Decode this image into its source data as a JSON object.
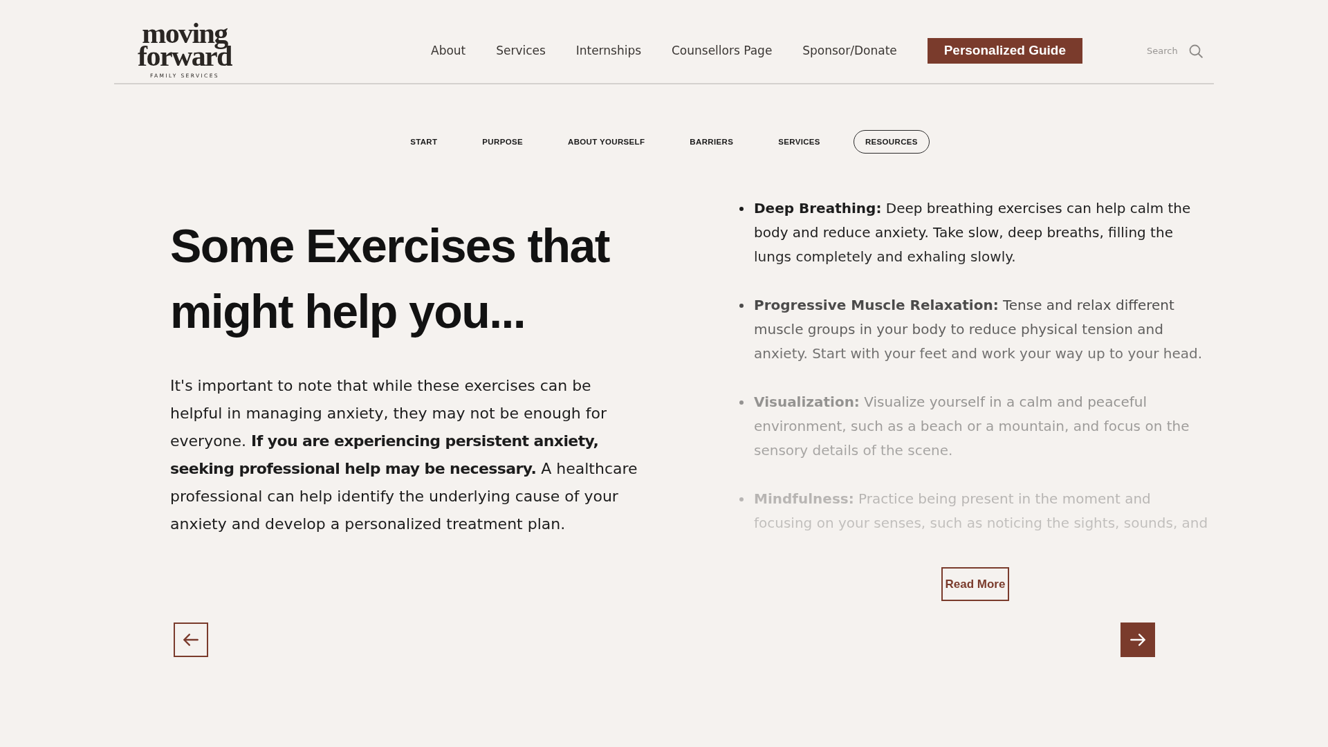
{
  "logo": {
    "wordmark": [
      "moving",
      "forward"
    ],
    "tagline": "FAMILY SERVICES"
  },
  "nav": {
    "items": [
      {
        "label": "About",
        "kind": "link"
      },
      {
        "label": "Services",
        "kind": "link"
      },
      {
        "label": "Internships",
        "kind": "link"
      },
      {
        "label": "Counsellors Page",
        "kind": "link"
      },
      {
        "label": "Sponsor/Donate",
        "kind": "link"
      },
      {
        "label": "Personalized Guide",
        "kind": "button"
      }
    ]
  },
  "search": {
    "placeholder": "Search"
  },
  "steps": [
    {
      "label": "START",
      "selected": false
    },
    {
      "label": "PURPOSE",
      "selected": false
    },
    {
      "label": "ABOUT YOURSELF",
      "selected": false
    },
    {
      "label": "BARRIERS",
      "selected": false
    },
    {
      "label": "SERVICES",
      "selected": false
    },
    {
      "label": "RESOURCES",
      "selected": true
    }
  ],
  "heading": "Some Exercises that might help you...",
  "intro": "It's important to note that while these exercises can be helpful in managing anxiety, they may not be enough for everyone. **If you are experiencing persistent anxiety, seeking professional help may be necessary.** A healthcare professional can help identify the underlying cause of your anxiety and develop a personalized treatment plan.",
  "exercises": {
    "expanded": false,
    "items": [
      "**Deep Breathing:** Deep breathing exercises can help calm the body and reduce anxiety. Take slow, deep breaths, filling the lungs completely and exhaling slowly.",
      "**Progressive Muscle Relaxation:** Tense and relax different muscle groups in your body to reduce physical tension and anxiety. Start with your feet and work your way up to your head.",
      "**Visualization:** Visualize yourself in a calm and peaceful environment, such as a beach or a mountain, and focus on the sensory details of the scene.",
      "**Mindfulness:** Practice being present in the moment and focusing on your senses, such as noticing the sights, sounds, and"
    ]
  },
  "read_more": "Read More",
  "pager": {
    "previous": {
      "kind": "outline"
    },
    "next": {
      "kind": "filled"
    }
  }
}
